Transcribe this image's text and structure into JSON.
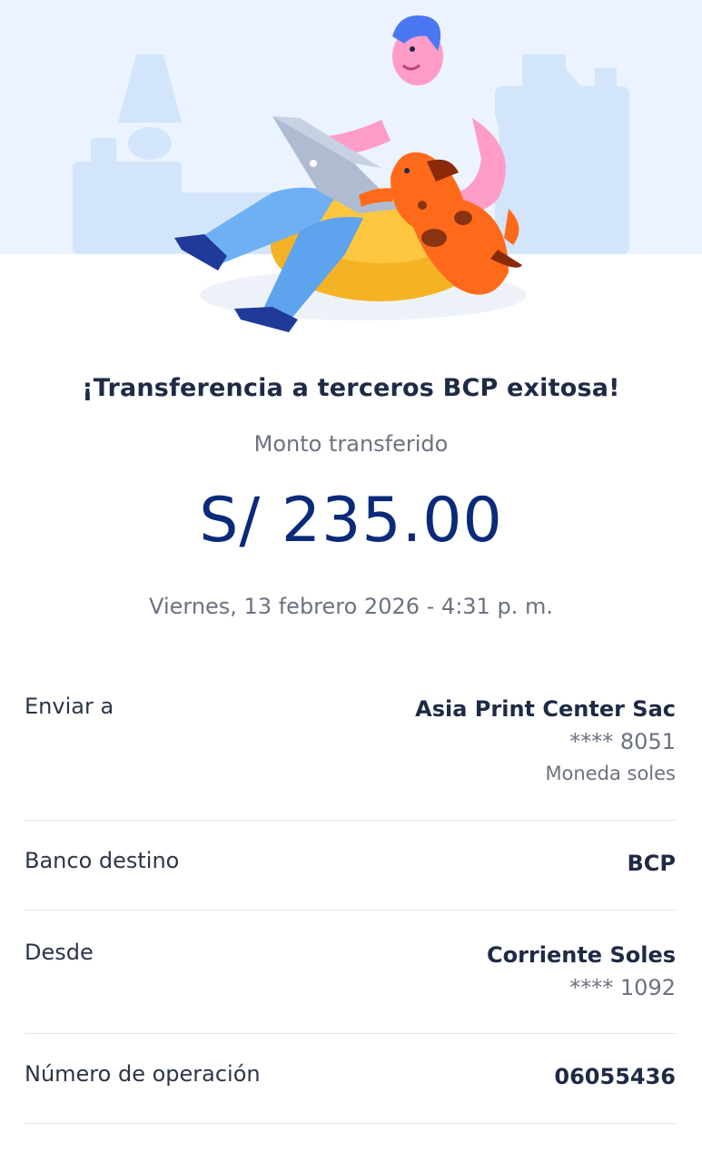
{
  "success": {
    "title": "¡Transferencia a terceros BCP exitosa!",
    "amount_label": "Monto transferido",
    "amount": "S/ 235.00",
    "datetime": "Viernes, 13 febrero 2026 - 4:31 p. m."
  },
  "details": {
    "recipient": {
      "label": "Enviar a",
      "name": "Asia Print Center Sac",
      "account": "**** 8051",
      "currency": "Moneda soles"
    },
    "bank": {
      "label": "Banco destino",
      "value": "BCP"
    },
    "origin": {
      "label": "Desde",
      "account_name": "Corriente Soles",
      "account": "**** 1092"
    },
    "operation": {
      "label": "Número de operación",
      "value": "06055436"
    }
  },
  "colors": {
    "hero_bg": "#eaf3ff",
    "amount": "#0a2a7a",
    "title": "#1f2a44",
    "muted": "#6b7280",
    "divider": "#e3e6ea"
  }
}
